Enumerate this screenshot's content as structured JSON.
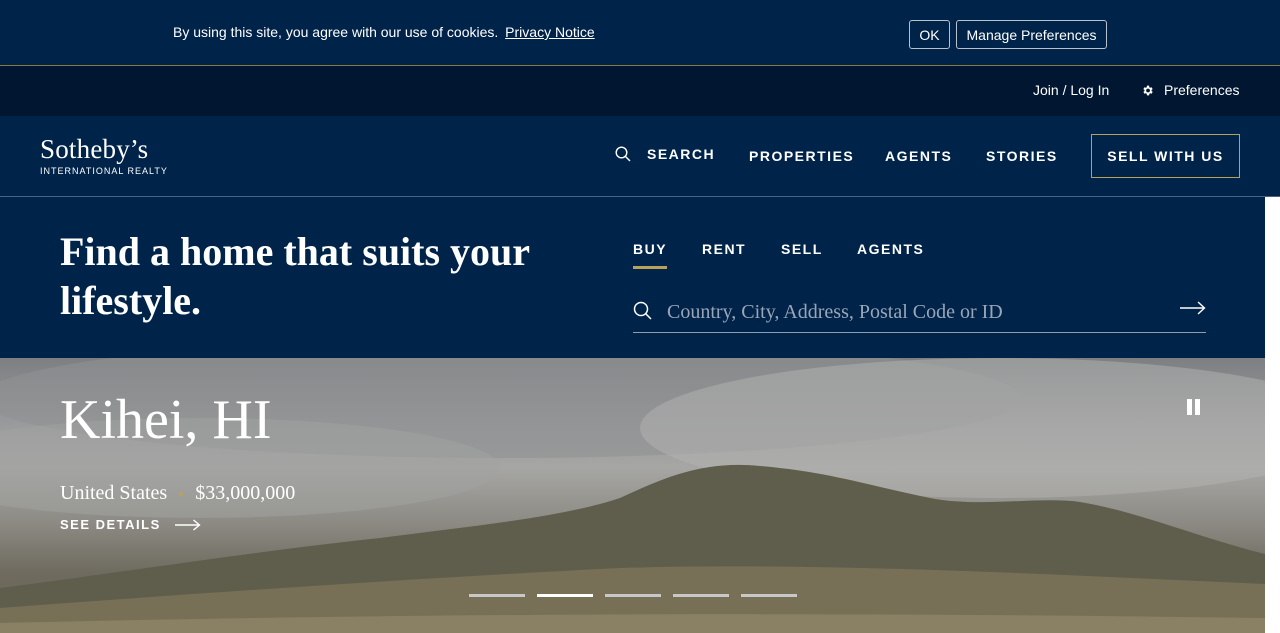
{
  "cookie": {
    "text": "By using this site, you agree with our use of cookies.",
    "link": "Privacy Notice",
    "ok": "OK",
    "manage": "Manage Preferences"
  },
  "utility": {
    "login": "Join / Log In",
    "preferences": "Preferences"
  },
  "brand": {
    "name": "Sotheby’s",
    "sub": "INTERNATIONAL REALTY"
  },
  "nav": {
    "search": "SEARCH",
    "properties": "PROPERTIES",
    "agents": "AGENTS",
    "stories": "STORIES",
    "sell": "SELL WITH US"
  },
  "hero": {
    "heading": "Find a home that suits your lifestyle.",
    "tabs": [
      "BUY",
      "RENT",
      "SELL",
      "AGENTS"
    ],
    "active_tab": "BUY",
    "search_placeholder": "Country, City, Address, Postal Code or ID"
  },
  "listing": {
    "city": "Kihei, HI",
    "country": "United States",
    "price": "$33,000,000",
    "details": "SEE DETAILS"
  },
  "carousel": {
    "slides": 5,
    "active_index": 1
  },
  "colors": {
    "navy": "#002349",
    "dark_navy": "#001631",
    "gold": "#b8a25a"
  }
}
